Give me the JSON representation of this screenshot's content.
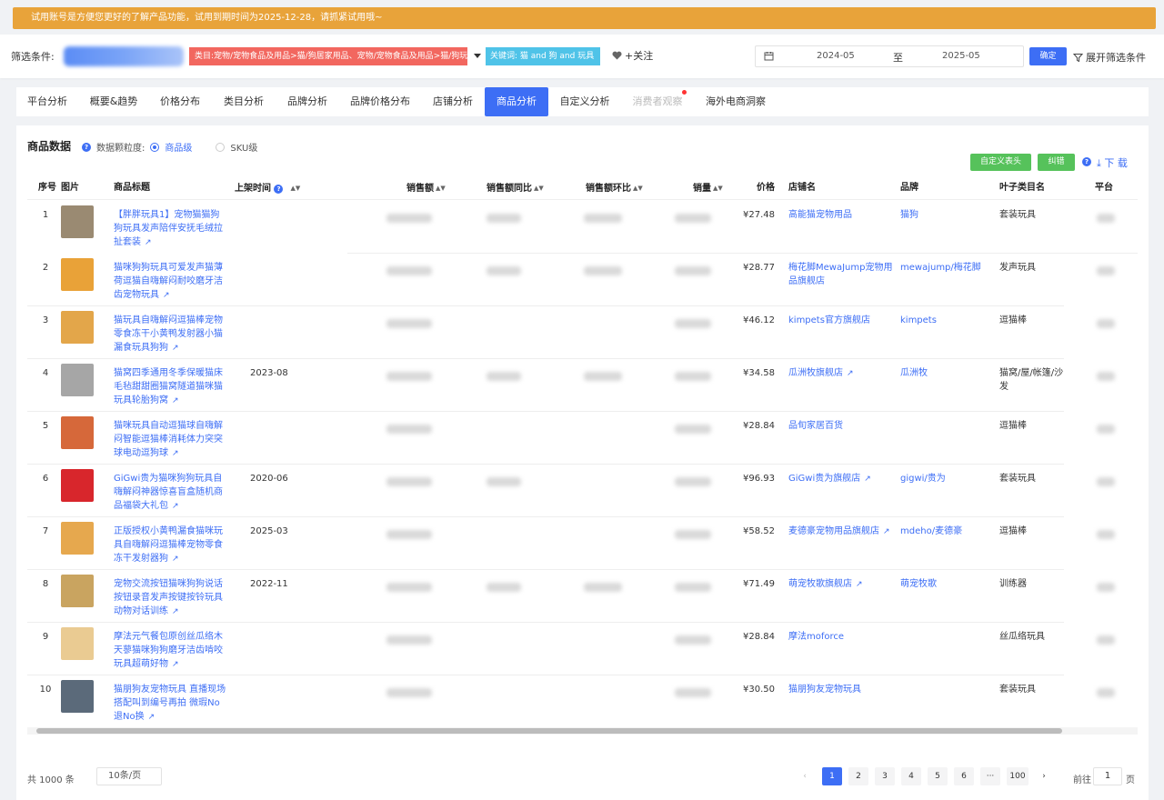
{
  "trial_banner": "试用账号是方便您更好的了解产品功能，试用到期时间为2025-12-28，请抓紧试用哦~",
  "filter": {
    "label": "筛选条件:",
    "category_tag": "类目:宠物/宠物食品及用品>猫/狗居家用品、宠物/宠物食品及用品>猫/狗玩具",
    "keyword_tag": "关键词: 猫 and 狗 and 玩具",
    "follow": "+关注",
    "date_from": "2024-05",
    "date_to_label": "至",
    "date_to": "2025-05",
    "confirm": "确定",
    "expand": "展开筛选条件"
  },
  "tabs": [
    {
      "label": "平台分析"
    },
    {
      "label": "概要&趋势"
    },
    {
      "label": "价格分布"
    },
    {
      "label": "类目分析"
    },
    {
      "label": "品牌分析"
    },
    {
      "label": "品牌价格分布"
    },
    {
      "label": "店铺分析"
    },
    {
      "label": "商品分析"
    },
    {
      "label": "自定义分析"
    },
    {
      "label": "消费者观察"
    },
    {
      "label": "海外电商洞察"
    }
  ],
  "section": {
    "title": "商品数据",
    "granularity_label": "数据颗粒度:",
    "option_product": "商品级",
    "option_sku": "SKU级",
    "custom_columns": "自定义表头",
    "correct": "纠错",
    "download": "下 载"
  },
  "table": {
    "headers": {
      "seq": "序号",
      "image": "图片",
      "title": "商品标题",
      "list_time": "上架时间",
      "sales": "销售额",
      "sales_yoy": "销售额同比",
      "sales_mom": "销售额环比",
      "volume": "销量",
      "price": "价格",
      "shop": "店铺名",
      "brand": "品牌",
      "leaf_category": "叶子类目名",
      "platform": "平台"
    },
    "rows": [
      {
        "seq": "1",
        "title": "【胖胖玩具1】宠物猫猫狗狗玩具发声陪伴安抚毛绒拉扯套装",
        "time": "",
        "price": "¥27.48",
        "shop": "高能猫宠物用品",
        "brand": "猫狗",
        "category": "套装玩具",
        "img": "#9a8a72",
        "yoy": true,
        "mom": true
      },
      {
        "seq": "2",
        "title": "猫咪狗狗玩具可爱发声猫薄荷逗猫自嗨解闷耐咬磨牙洁齿宠物玩具",
        "time": "",
        "price": "¥28.77",
        "shop": "梅花脚MewaJump宠物用品旗舰店",
        "brand": "mewajump/梅花脚",
        "category": "发声玩具",
        "img": "#e9a238",
        "yoy": true,
        "mom": true
      },
      {
        "seq": "3",
        "title": "猫玩具自嗨解闷逗猫棒宠物零食冻干小黄鸭发射器小猫漏食玩具狗狗",
        "time": "",
        "price": "¥46.12",
        "shop": "kimpets官方旗舰店",
        "brand": "kimpets",
        "category": "逗猫棒",
        "img": "#e3a64a",
        "yoy": false,
        "mom": false
      },
      {
        "seq": "4",
        "title": "猫窝四季通用冬季保暖猫床毛毡甜甜圈猫窝隧道猫咪猫玩具轮胎狗窝",
        "time": "2023-08",
        "price": "¥34.58",
        "shop": "瓜洲牧旗舰店",
        "brand": "瓜洲牧",
        "category": "猫窝/屋/帐篷/沙发",
        "img": "#a6a6a6",
        "yoy": true,
        "mom": true
      },
      {
        "seq": "5",
        "title": "猫咪玩具自动逗猫球自嗨解闷智能逗猫棒消耗体力突突球电动逗狗球",
        "time": "",
        "price": "¥28.84",
        "shop": "品旬家居百货",
        "brand": "",
        "category": "逗猫棒",
        "img": "#d6683a",
        "yoy": false,
        "mom": false
      },
      {
        "seq": "6",
        "title": "GiGwi贵为猫咪狗狗玩具自嗨解闷神器惊喜盲盒随机商品福袋大礼包",
        "time": "2020-06",
        "price": "¥96.93",
        "shop": "GiGwi贵为旗舰店",
        "brand": "gigwi/贵为",
        "category": "套装玩具",
        "img": "#d8262c",
        "yoy": true,
        "mom": false
      },
      {
        "seq": "7",
        "title": "正版授权小黄鸭漏食猫咪玩具自嗨解闷逗猫棒宠物零食冻干发射器狗",
        "time": "2025-03",
        "price": "¥58.52",
        "shop": "麦德豪宠物用品旗舰店",
        "brand": "mdeho/麦德豪",
        "category": "逗猫棒",
        "img": "#e6a84e",
        "yoy": false,
        "mom": false
      },
      {
        "seq": "8",
        "title": "宠物交流按钮猫咪狗狗说话按钮录音发声按键按铃玩具动物对话训练",
        "time": "2022-11",
        "price": "¥71.49",
        "shop": "萌宠牧歌旗舰店",
        "brand": "萌宠牧歌",
        "category": "训练器",
        "img": "#c9a460",
        "yoy": true,
        "mom": true
      },
      {
        "seq": "9",
        "title": "摩法元气餐包原创丝瓜络木天蓼猫咪狗狗磨牙洁齿啃咬玩具超萌好物",
        "time": "",
        "price": "¥28.84",
        "shop": "摩法moforce",
        "brand": "",
        "category": "丝瓜络玩具",
        "img": "#eacb92",
        "yoy": false,
        "mom": false
      },
      {
        "seq": "10",
        "title": "猫朋狗友宠物玩具 直播现场搭配叫到编号再拍 微瑕No退No换",
        "time": "",
        "price": "¥30.50",
        "shop": "猫朋狗友宠物玩具",
        "brand": "",
        "category": "套装玩具",
        "img": "#5b6a7a",
        "yoy": false,
        "mom": false
      }
    ]
  },
  "pagination": {
    "total": "共 1000 条",
    "page_size": "10条/页",
    "pages": [
      "1",
      "2",
      "3",
      "4",
      "5",
      "6",
      "···",
      "100"
    ],
    "current": "1",
    "goto_label": "前往",
    "goto_value": "1",
    "goto_suffix": "页"
  },
  "colors": {
    "primary": "#3d6ef5",
    "banner": "#e8a33a",
    "category_tag": "#f2675f",
    "keyword_tag": "#4fc3e8",
    "success": "#56c25b"
  }
}
